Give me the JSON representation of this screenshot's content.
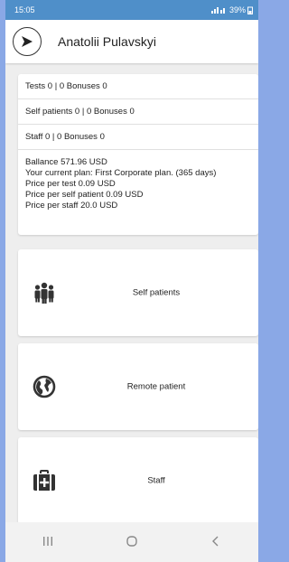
{
  "status": {
    "time": "15:05",
    "indicators": "39%"
  },
  "header": {
    "user_name": "Anatolii Pulavskyi",
    "avatar_icon": "send-arrow-icon"
  },
  "summary": {
    "tests": "Tests 0 | 0 Bonuses 0",
    "self_patients": "Self patients 0 | 0 Bonuses 0",
    "staff": "Staff 0 | 0 Bonuses 0",
    "balance": "Ballance 571.96 USD",
    "plan": "Your current plan: First Corporate plan. (365 days)",
    "price_test": "Price per test 0.09 USD",
    "price_self_patient": "Price per self patient 0.09 USD",
    "price_staff": "Price per staff 20.0 USD"
  },
  "tiles": {
    "self_patients": {
      "label": "Self patients",
      "icon": "group-icon"
    },
    "remote_patient": {
      "label": "Remote patient",
      "icon": "globe-icon"
    },
    "staff": {
      "label": "Staff",
      "icon": "medical-kit-icon"
    }
  },
  "navbar": {
    "recent": "recent-apps-icon",
    "home": "home-circle-icon",
    "back": "back-chevron-icon"
  },
  "colors": {
    "status_bar": "#4f8fc9",
    "background": "#eeeeee",
    "frame": "#8aa8e6"
  }
}
